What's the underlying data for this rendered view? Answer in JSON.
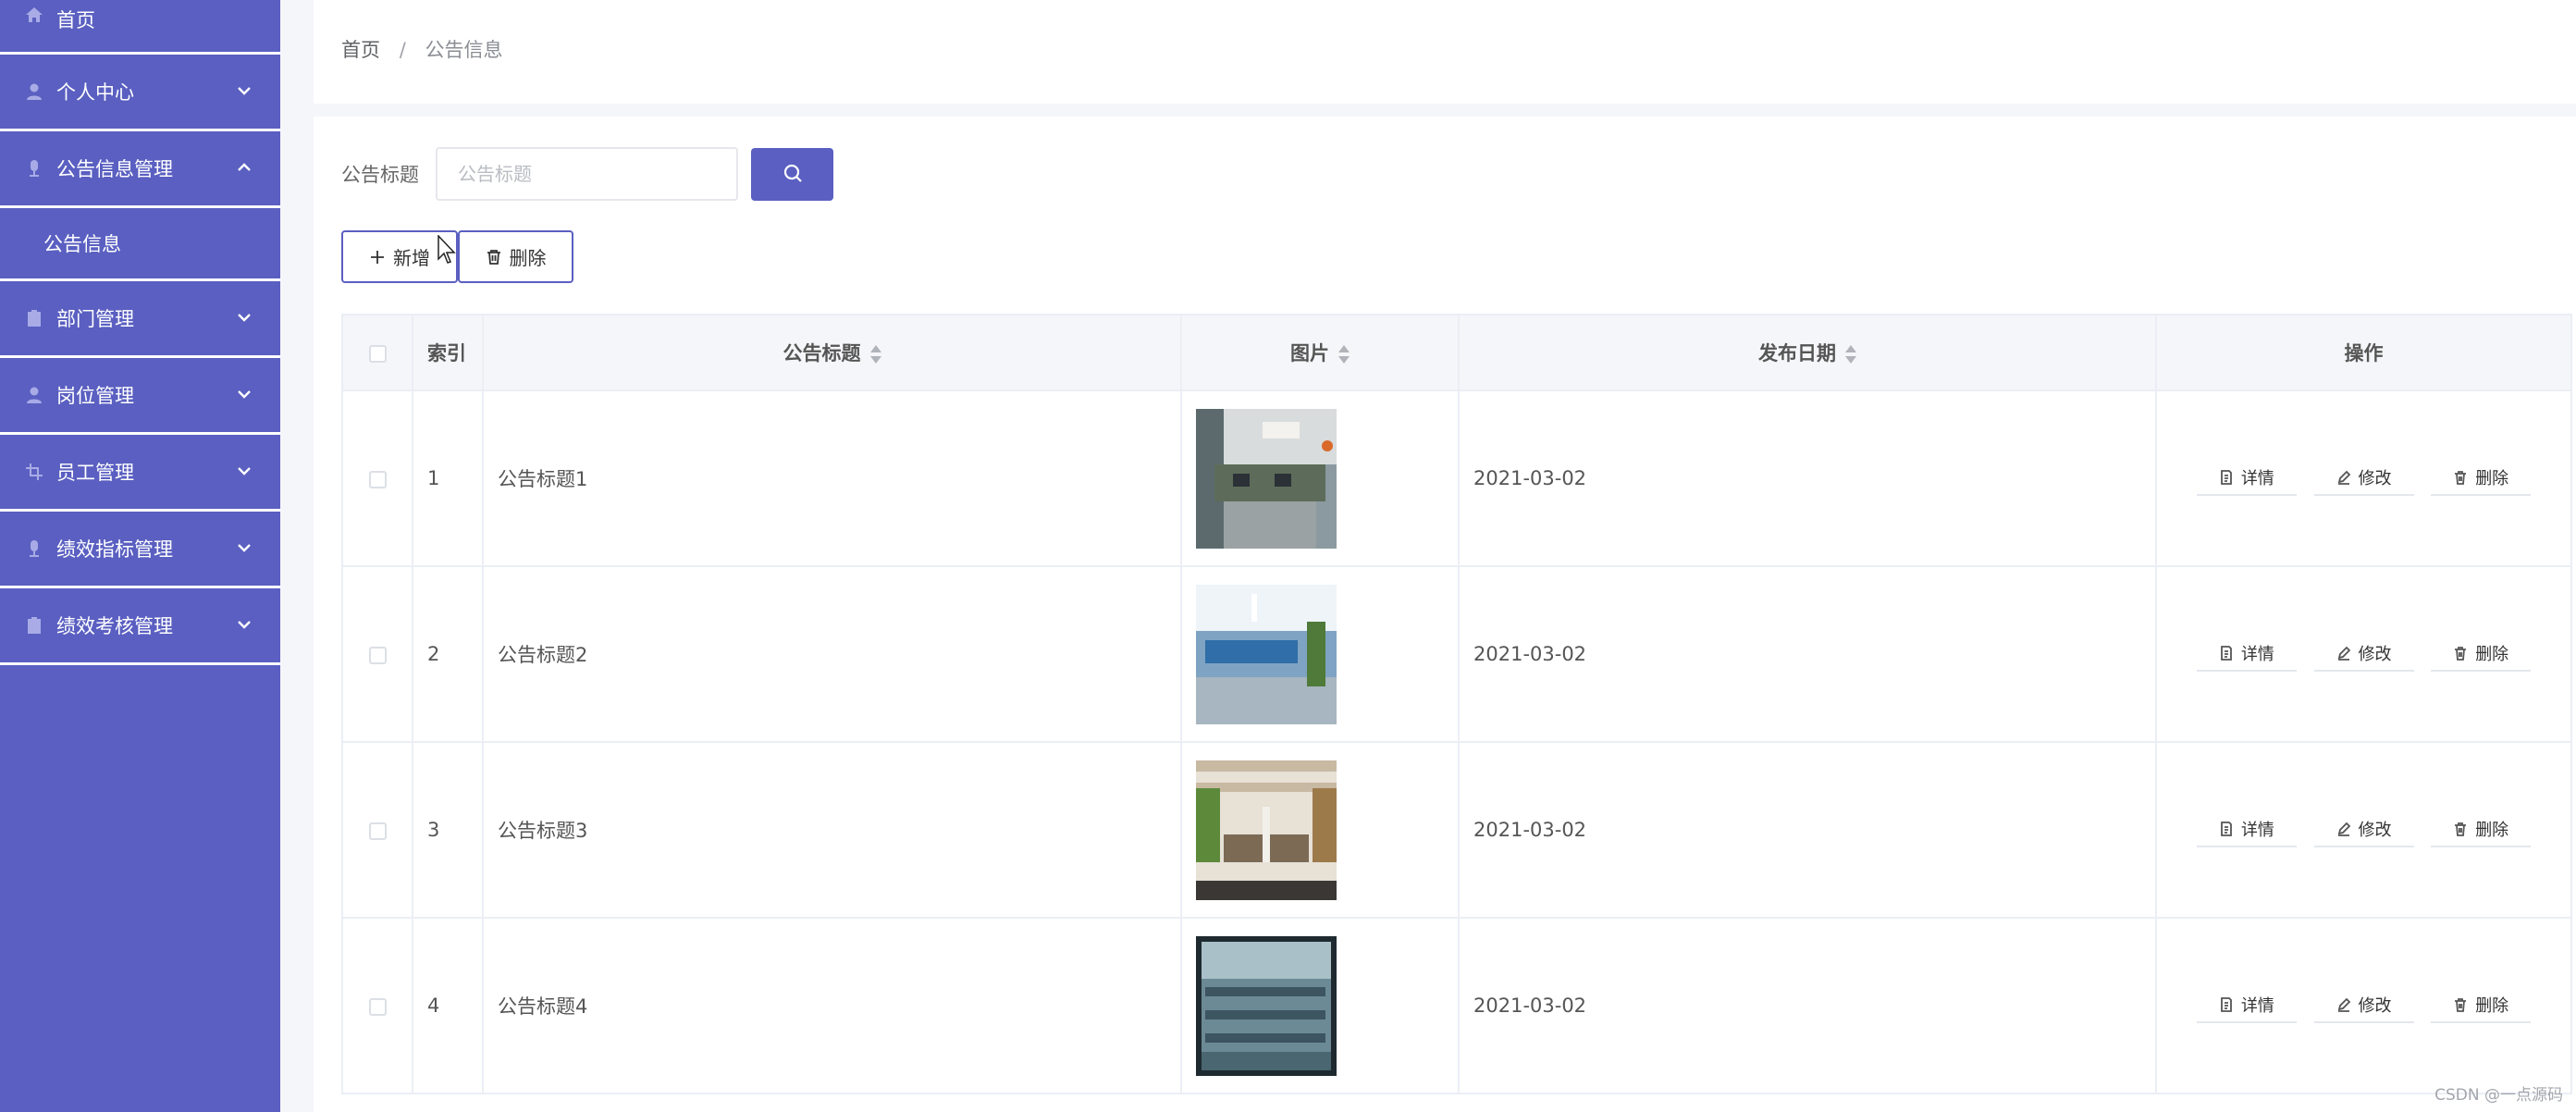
{
  "sidebar": {
    "items": [
      {
        "label": "首页",
        "icon": "home-icon"
      },
      {
        "label": "个人中心",
        "icon": "user-icon"
      },
      {
        "label": "公告信息管理",
        "icon": "mic-icon",
        "expanded": true,
        "submenu": [
          {
            "label": "公告信息"
          }
        ]
      },
      {
        "label": "部门管理",
        "icon": "clipboard-icon"
      },
      {
        "label": "岗位管理",
        "icon": "user-icon"
      },
      {
        "label": "员工管理",
        "icon": "crop-icon"
      },
      {
        "label": "绩效指标管理",
        "icon": "mic-icon"
      },
      {
        "label": "绩效考核管理",
        "icon": "clipboard-icon"
      }
    ]
  },
  "breadcrumb": {
    "home": "首页",
    "separator": "/",
    "current": "公告信息"
  },
  "search": {
    "label": "公告标题",
    "placeholder": "公告标题"
  },
  "toolbar": {
    "add_label": "新增",
    "delete_label": "删除"
  },
  "table": {
    "headers": {
      "index": "索引",
      "title": "公告标题",
      "image": "图片",
      "date": "发布日期",
      "actions": "操作"
    },
    "rows": [
      {
        "index": "1",
        "title": "公告标题1",
        "date": "2021-03-02"
      },
      {
        "index": "2",
        "title": "公告标题2",
        "date": "2021-03-02"
      },
      {
        "index": "3",
        "title": "公告标题3",
        "date": "2021-03-02"
      },
      {
        "index": "4",
        "title": "公告标题4",
        "date": "2021-03-02"
      }
    ],
    "row_actions": {
      "detail": "详情",
      "edit": "修改",
      "delete": "删除"
    }
  },
  "watermark": "CSDN @一点源码",
  "colors": {
    "sidebar": "#5a5fc1",
    "accent": "#5a5fc1",
    "background": "#f5f6fa"
  }
}
